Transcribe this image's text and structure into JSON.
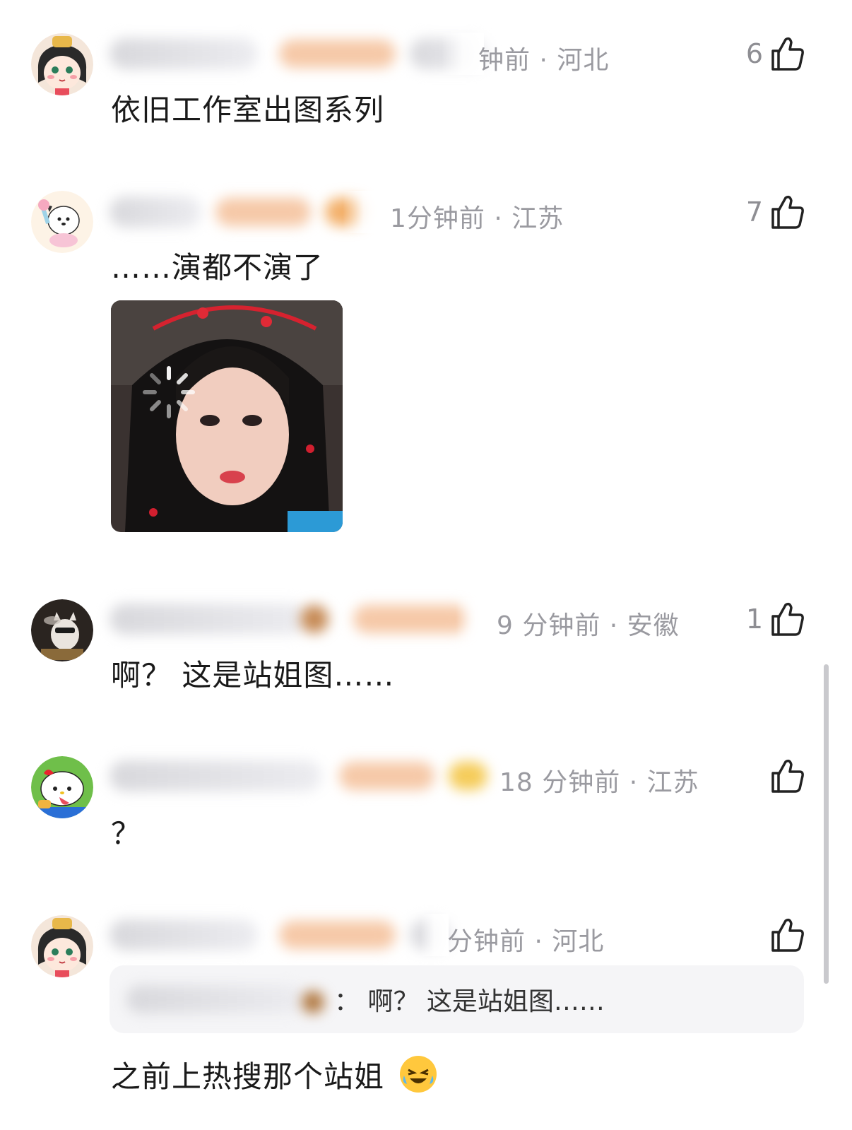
{
  "comments": [
    {
      "time_location": "钟前 · 河北",
      "likes": "6",
      "text": "依旧工作室出图系列"
    },
    {
      "time_location": "1分钟前 · 江苏",
      "likes": "7",
      "text": "……演都不演了"
    },
    {
      "time_location": "9 分钟前 · 安徽",
      "likes": "1",
      "text": "啊？ 这是站姐图……"
    },
    {
      "time_location": "18 分钟前 · 江苏",
      "likes": "",
      "text": "？"
    },
    {
      "time_location": "分钟前 · 河北",
      "likes": "",
      "text": "之前上热搜那个站姐",
      "quote": {
        "text": "：  啊？ 这是站姐图……"
      }
    }
  ],
  "icons": {
    "like": "thumbs-up-icon",
    "loading": "loading-spinner-icon",
    "emoji": "crying-laughing-emoji-icon"
  },
  "colors": {
    "meta_gray": "#9a9aa0",
    "text": "#1a1a1a",
    "quote_bg": "#f5f5f7"
  }
}
